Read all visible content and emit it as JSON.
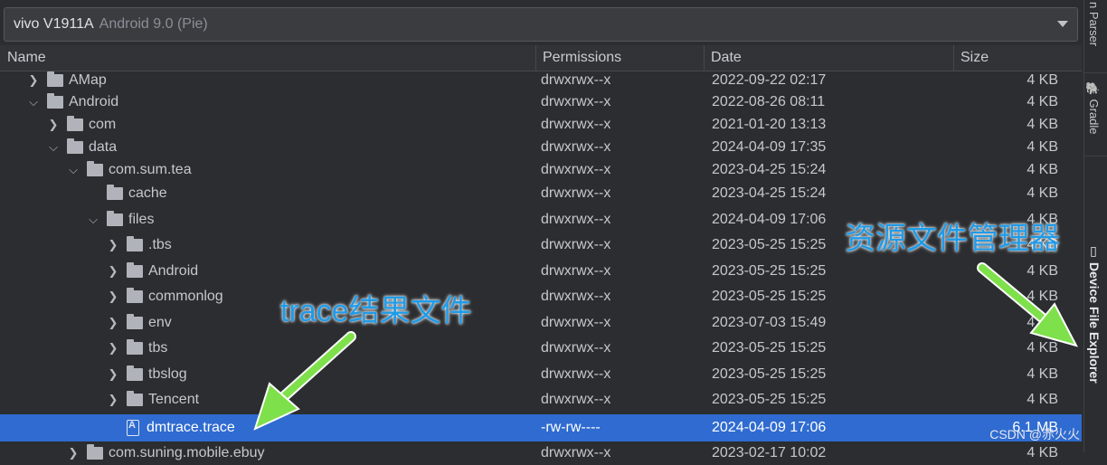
{
  "device": {
    "model": "vivo V1911A",
    "os": "Android 9.0 (Pie)"
  },
  "columns": {
    "name": "Name",
    "permissions": "Permissions",
    "date": "Date",
    "size": "Size"
  },
  "rows": [
    {
      "name": "AMap",
      "permissions": "drwxrwx--x",
      "date": "2022-09-22 02:17",
      "size": "4 KB"
    },
    {
      "name": "Android",
      "permissions": "drwxrwx--x",
      "date": "2022-08-26 08:11",
      "size": "4 KB"
    },
    {
      "name": "com",
      "permissions": "drwxrwx--x",
      "date": "2021-01-20 13:13",
      "size": "4 KB"
    },
    {
      "name": "data",
      "permissions": "drwxrwx--x",
      "date": "2024-04-09 17:35",
      "size": "4 KB"
    },
    {
      "name": "com.sum.tea",
      "permissions": "drwxrwx--x",
      "date": "2023-04-25 15:24",
      "size": "4 KB"
    },
    {
      "name": "cache",
      "permissions": "drwxrwx--x",
      "date": "2023-04-25 15:24",
      "size": "4 KB"
    },
    {
      "name": "files",
      "permissions": "drwxrwx--x",
      "date": "2024-04-09 17:06",
      "size": "4 KB"
    },
    {
      "name": ".tbs",
      "permissions": "drwxrwx--x",
      "date": "2023-05-25 15:25",
      "size": "4 KB"
    },
    {
      "name": "Android",
      "permissions": "drwxrwx--x",
      "date": "2023-05-25 15:25",
      "size": "4 KB"
    },
    {
      "name": "commonlog",
      "permissions": "drwxrwx--x",
      "date": "2023-05-25 15:25",
      "size": "4 KB"
    },
    {
      "name": "env",
      "permissions": "drwxrwx--x",
      "date": "2023-07-03 15:49",
      "size": "4 KB"
    },
    {
      "name": "tbs",
      "permissions": "drwxrwx--x",
      "date": "2023-05-25 15:25",
      "size": "4 KB"
    },
    {
      "name": "tbslog",
      "permissions": "drwxrwx--x",
      "date": "2023-05-25 15:25",
      "size": "4 KB"
    },
    {
      "name": "Tencent",
      "permissions": "drwxrwx--x",
      "date": "2023-05-25 15:25",
      "size": "4 KB"
    },
    {
      "name": "dmtrace.trace",
      "permissions": "-rw-rw----",
      "date": "2024-04-09 17:06",
      "size": "6.1 MB"
    },
    {
      "name": "com.suning.mobile.ebuy",
      "permissions": "drwxrwx--x",
      "date": "2023-02-17 10:02",
      "size": "4 KB"
    }
  ],
  "side_panels": {
    "json_parser": "n Parser",
    "gradle": "Gradle",
    "device_explorer": "Device File Explorer"
  },
  "annotations": {
    "file_manager": "资源文件管理器",
    "trace_result": "trace结果文件"
  },
  "watermark": "CSDN @赤火火",
  "colors": {
    "selected_row": "#2f6bd0",
    "annotation_blue": "#1f9be8",
    "arrow_green": "#7ee04a",
    "background": "#2b2d30"
  }
}
